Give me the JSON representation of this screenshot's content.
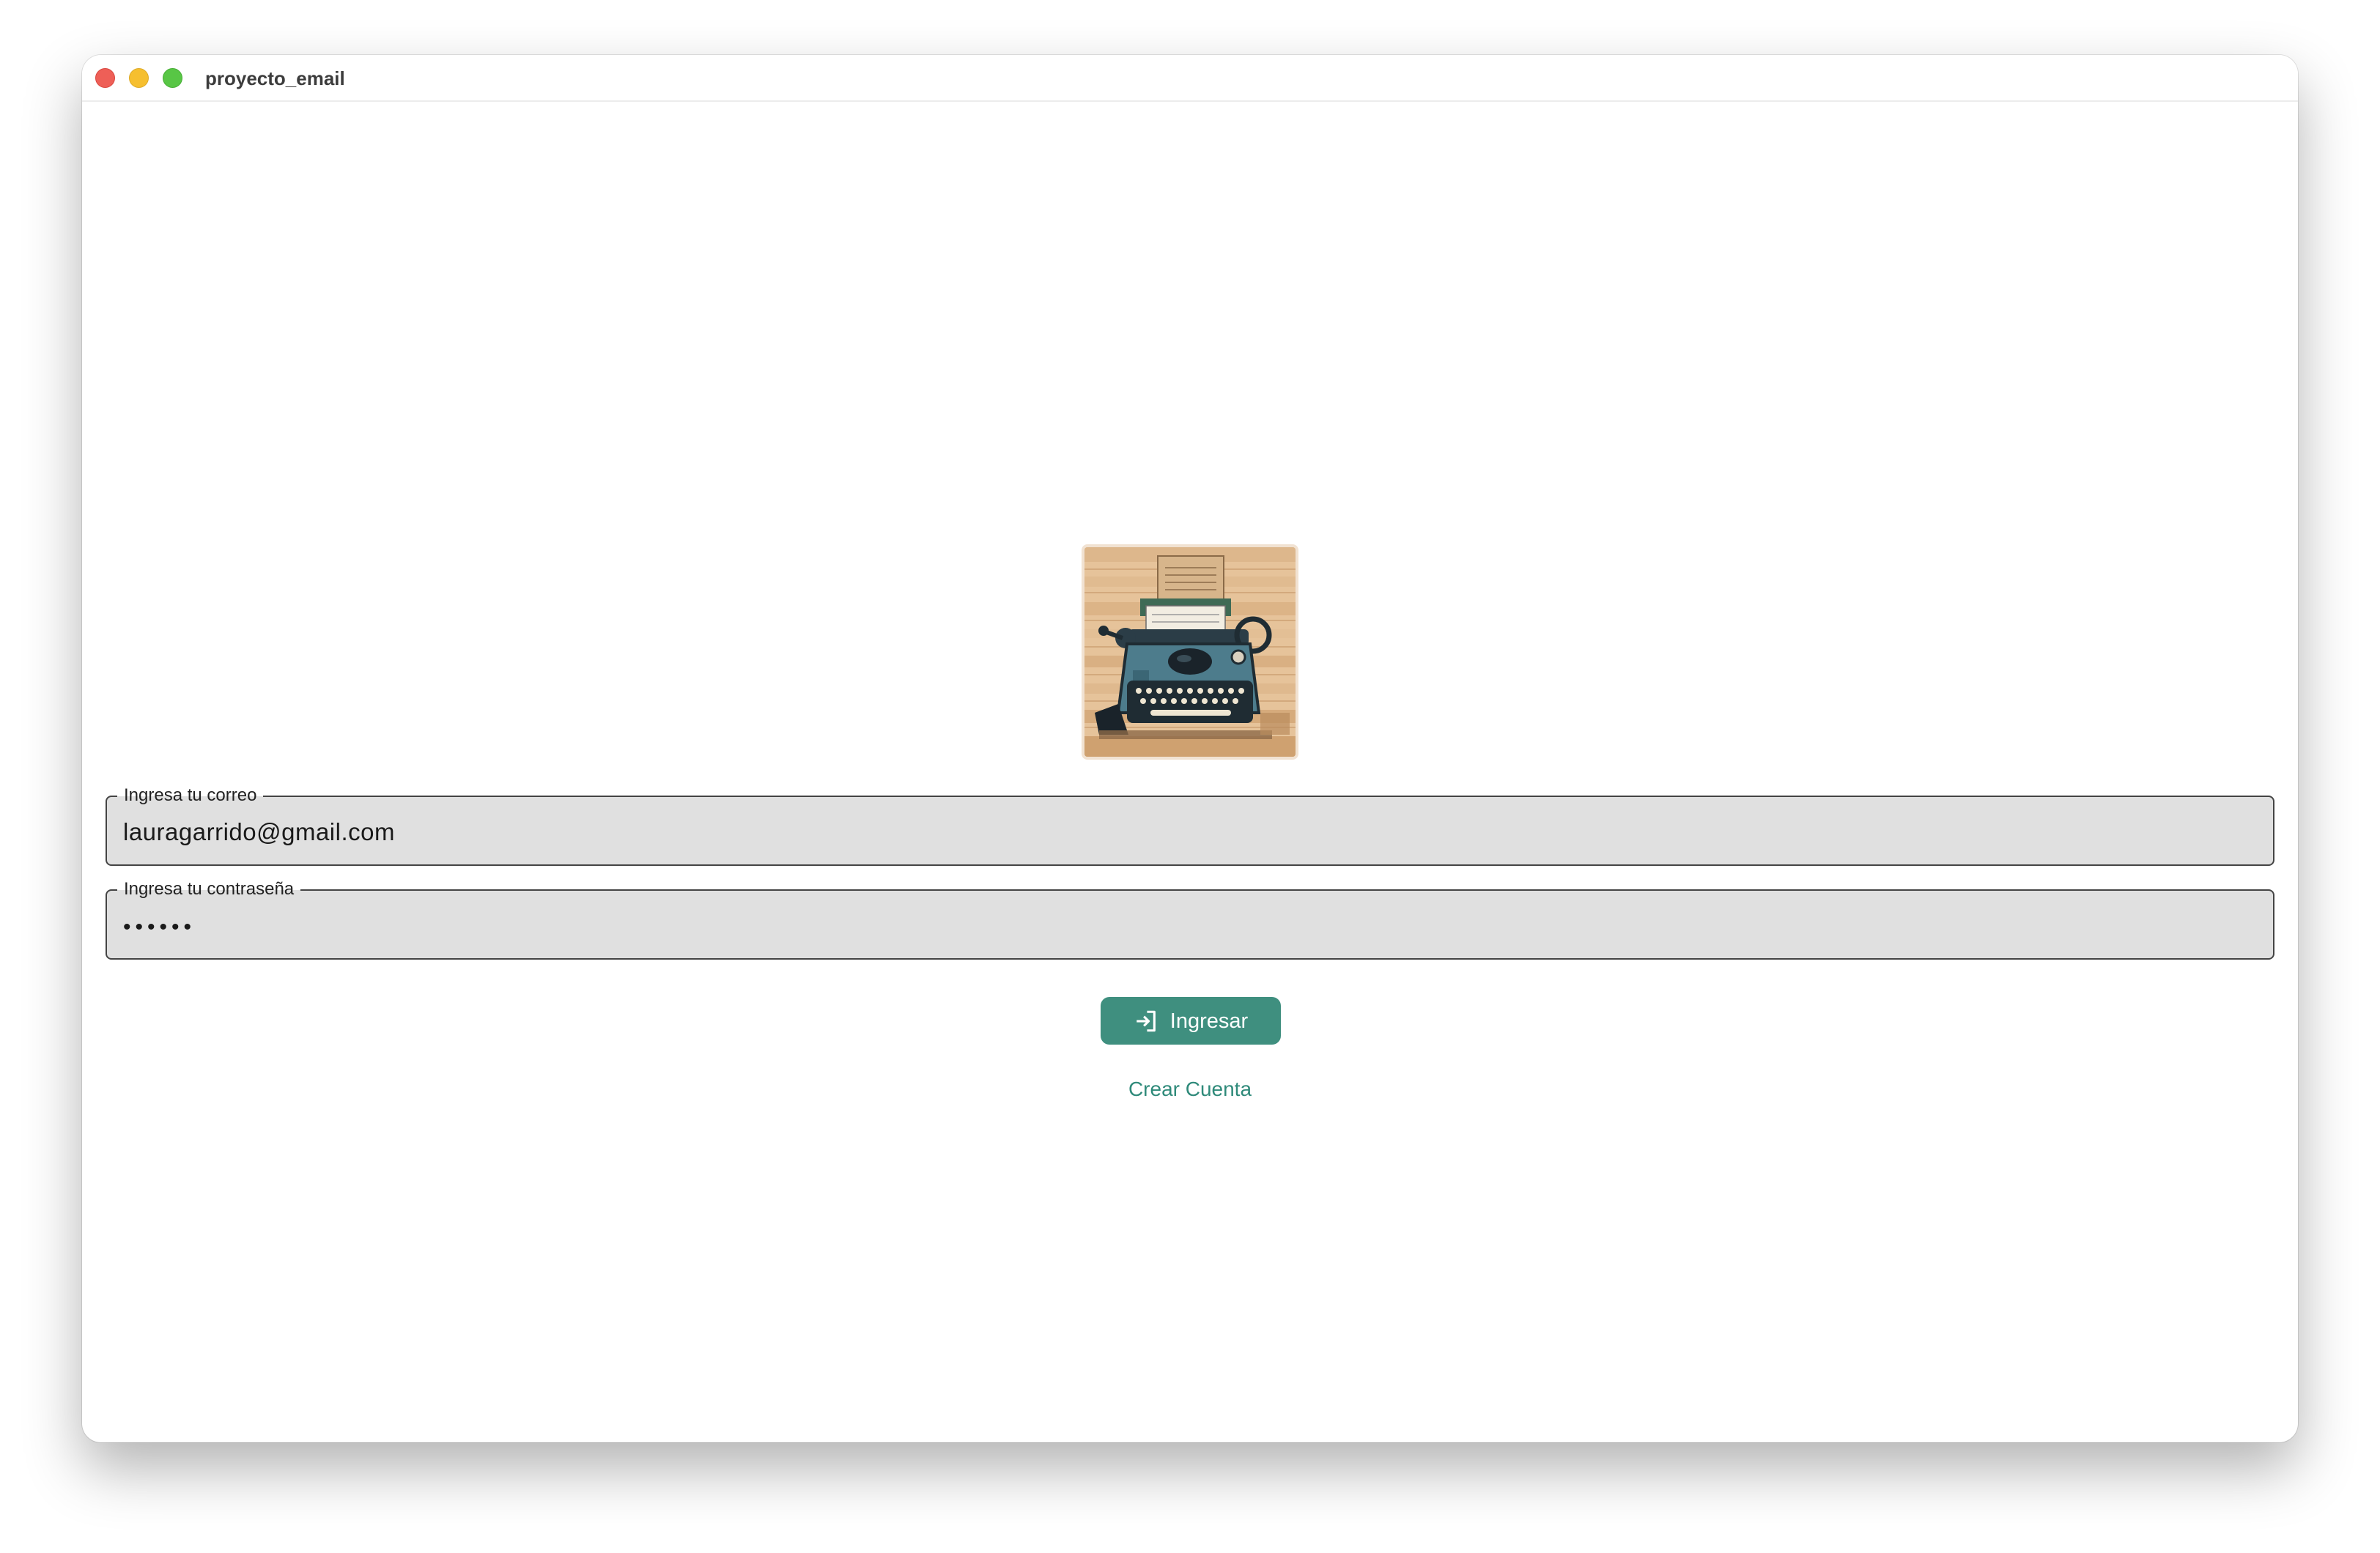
{
  "window": {
    "title": "proyecto_email"
  },
  "logo": {
    "description_icon": "typewriter-illustration"
  },
  "form": {
    "email": {
      "label": "Ingresa tu correo",
      "value": "lauragarrido@gmail.com"
    },
    "password": {
      "label": "Ingresa tu contraseña",
      "value": "••••••"
    },
    "login_button": {
      "label": "Ingresar",
      "icon": "login-icon"
    },
    "create_account_link": "Crear Cuenta"
  },
  "colors": {
    "accent": "#3f8f7f",
    "link": "#2f8a7a",
    "field_background": "#e0e0e0",
    "traffic_close": "#ee5f57",
    "traffic_minimize": "#f6bf2f",
    "traffic_maximize": "#58c645"
  }
}
